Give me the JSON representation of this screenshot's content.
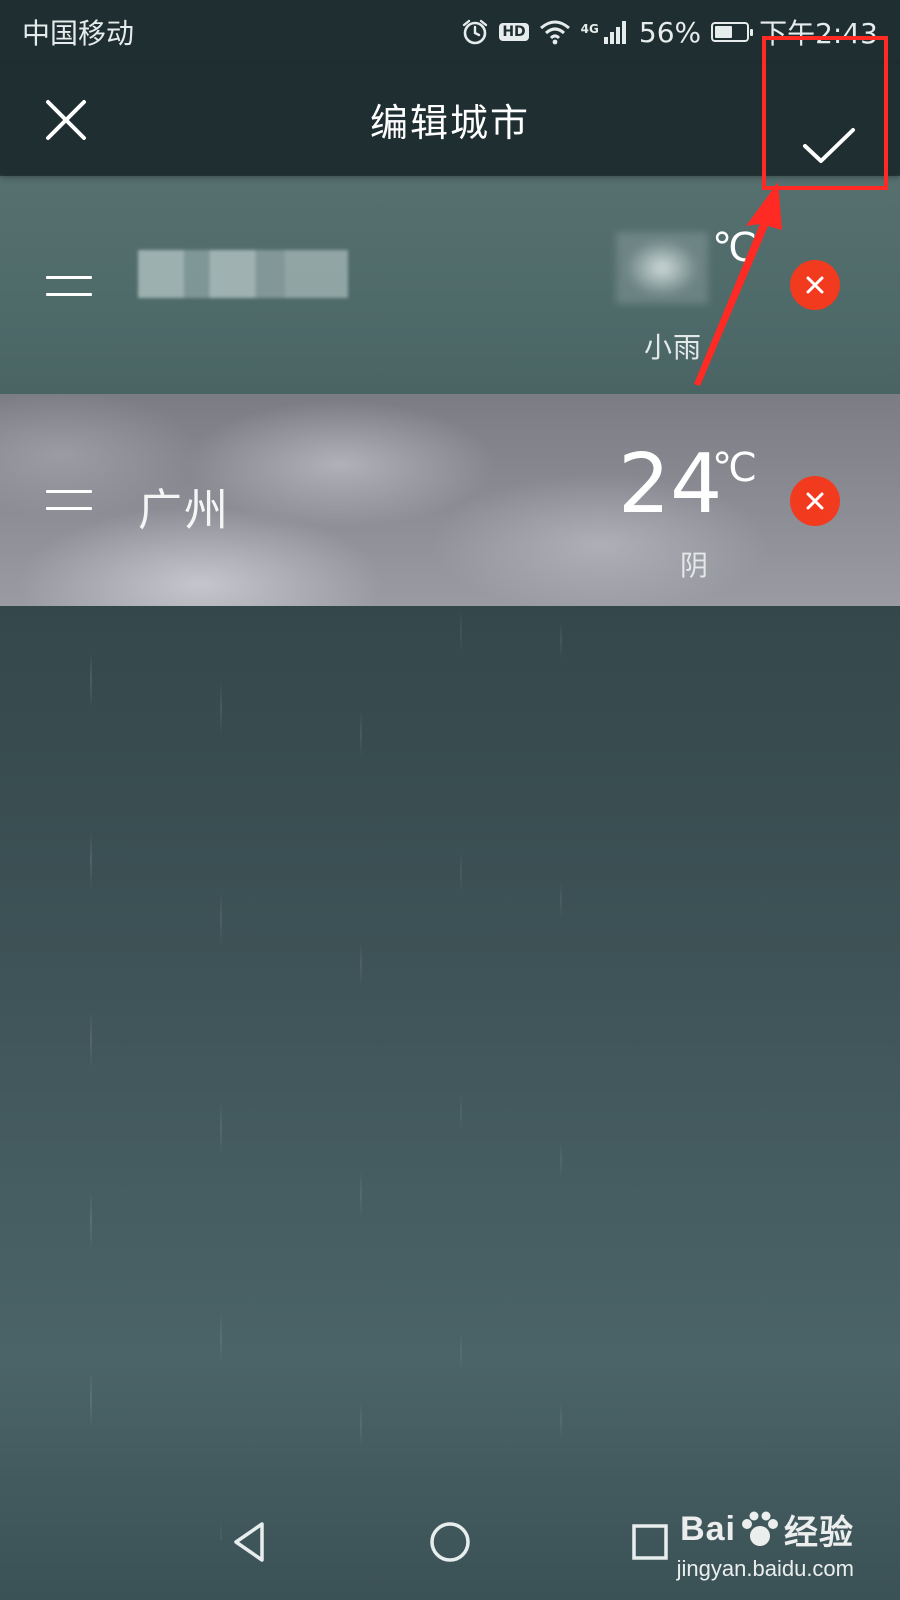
{
  "status_bar": {
    "carrier": "中国移动",
    "hd_badge": "HD",
    "network_type": "4G",
    "battery_percent": "56%",
    "battery_level": 0.56,
    "time": "下午2:43",
    "icons": [
      "alarm-icon",
      "hd-icon",
      "wifi-icon",
      "signal-icon",
      "battery-icon"
    ]
  },
  "title_bar": {
    "title": "编辑城市",
    "close_icon": "close-icon",
    "confirm_icon": "check-icon"
  },
  "cities": [
    {
      "name": "",
      "name_obscured": true,
      "temperature": "",
      "temperature_obscured": true,
      "unit": "℃",
      "weather": "小雨"
    },
    {
      "name": "广州",
      "name_obscured": false,
      "temperature": "24",
      "temperature_obscured": false,
      "unit": "℃",
      "weather": "阴"
    }
  ],
  "nav_bar": {
    "icons": [
      "back-icon",
      "home-icon",
      "recents-icon"
    ]
  },
  "watermark": {
    "brand": "Bai",
    "brand_suffix": "经验",
    "url": "jingyan.baidu.com"
  },
  "colors": {
    "bar_background": "#1f2e31",
    "delete_red": "#f23a1f",
    "annotation_red": "#ff2a24"
  }
}
